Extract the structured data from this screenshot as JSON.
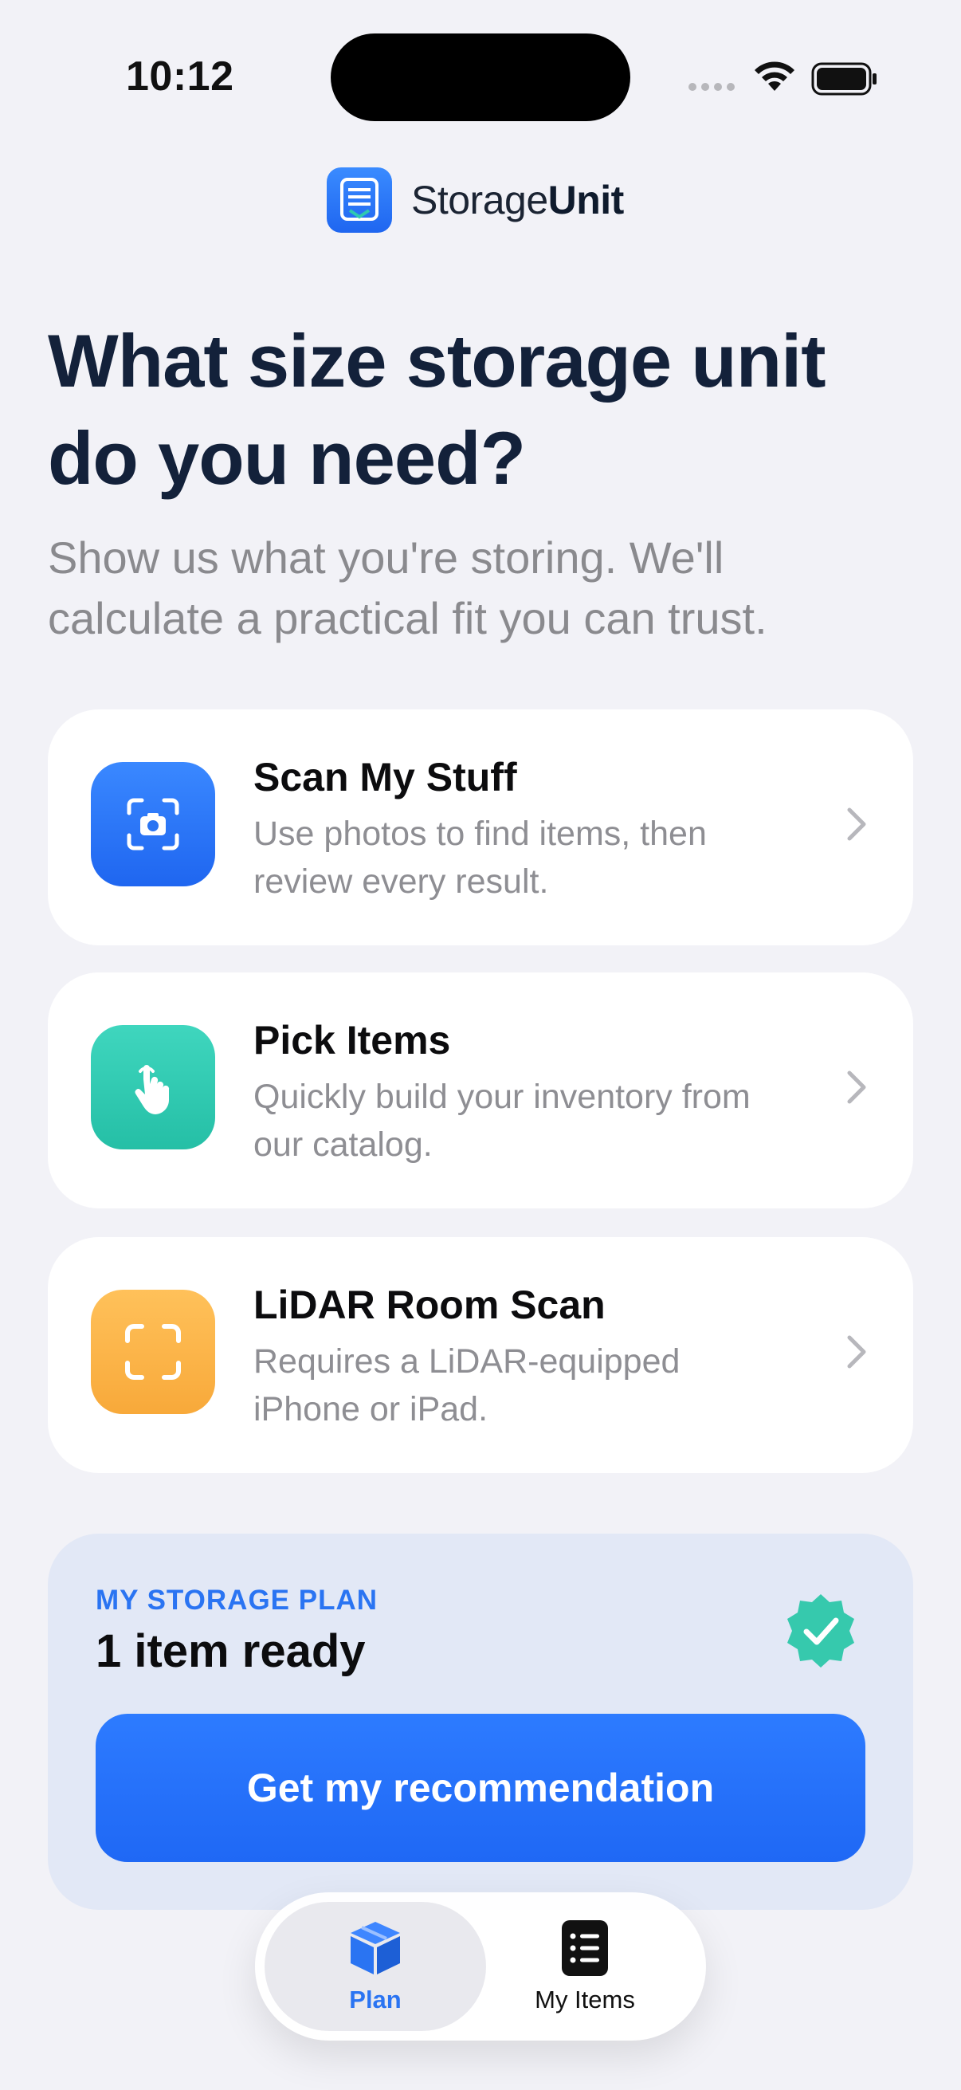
{
  "status_bar": {
    "time": "10:12"
  },
  "brand": {
    "name_regular": "Storage",
    "name_bold": "Unit"
  },
  "headline": "What size storage unit do you need?",
  "subheadline": "Show us what you're storing. We'll calculate a practical fit you can trust.",
  "options": [
    {
      "title": "Scan My Stuff",
      "description": "Use photos to find items, then review every result.",
      "icon": "camera-scan-icon",
      "color": "#2a74f2"
    },
    {
      "title": "Pick Items",
      "description": "Quickly build your inventory from our catalog.",
      "icon": "tap-hand-icon",
      "color": "#2ec9b0"
    },
    {
      "title": "LiDAR Room Scan",
      "description": "Requires a LiDAR-equipped iPhone or iPad.",
      "icon": "scan-frame-icon",
      "color": "#fbb13c"
    }
  ],
  "plan": {
    "label": "MY STORAGE PLAN",
    "count": "1 item ready",
    "cta": "Get my recommendation"
  },
  "tabs": [
    {
      "label": "Plan",
      "icon": "box-icon",
      "active": true
    },
    {
      "label": "My Items",
      "icon": "list-icon",
      "active": false
    }
  ]
}
